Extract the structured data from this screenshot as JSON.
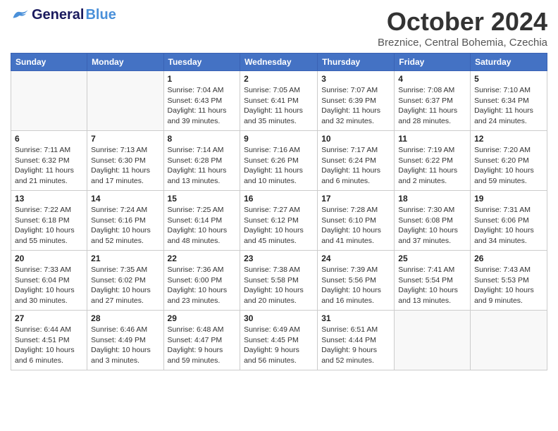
{
  "header": {
    "logo_general": "General",
    "logo_blue": "Blue",
    "month_title": "October 2024",
    "location": "Breznice, Central Bohemia, Czechia"
  },
  "weekdays": [
    "Sunday",
    "Monday",
    "Tuesday",
    "Wednesday",
    "Thursday",
    "Friday",
    "Saturday"
  ],
  "weeks": [
    [
      {
        "day": "",
        "sunrise": "",
        "sunset": "",
        "daylight": ""
      },
      {
        "day": "",
        "sunrise": "",
        "sunset": "",
        "daylight": ""
      },
      {
        "day": "1",
        "sunrise": "Sunrise: 7:04 AM",
        "sunset": "Sunset: 6:43 PM",
        "daylight": "Daylight: 11 hours and 39 minutes."
      },
      {
        "day": "2",
        "sunrise": "Sunrise: 7:05 AM",
        "sunset": "Sunset: 6:41 PM",
        "daylight": "Daylight: 11 hours and 35 minutes."
      },
      {
        "day": "3",
        "sunrise": "Sunrise: 7:07 AM",
        "sunset": "Sunset: 6:39 PM",
        "daylight": "Daylight: 11 hours and 32 minutes."
      },
      {
        "day": "4",
        "sunrise": "Sunrise: 7:08 AM",
        "sunset": "Sunset: 6:37 PM",
        "daylight": "Daylight: 11 hours and 28 minutes."
      },
      {
        "day": "5",
        "sunrise": "Sunrise: 7:10 AM",
        "sunset": "Sunset: 6:34 PM",
        "daylight": "Daylight: 11 hours and 24 minutes."
      }
    ],
    [
      {
        "day": "6",
        "sunrise": "Sunrise: 7:11 AM",
        "sunset": "Sunset: 6:32 PM",
        "daylight": "Daylight: 11 hours and 21 minutes."
      },
      {
        "day": "7",
        "sunrise": "Sunrise: 7:13 AM",
        "sunset": "Sunset: 6:30 PM",
        "daylight": "Daylight: 11 hours and 17 minutes."
      },
      {
        "day": "8",
        "sunrise": "Sunrise: 7:14 AM",
        "sunset": "Sunset: 6:28 PM",
        "daylight": "Daylight: 11 hours and 13 minutes."
      },
      {
        "day": "9",
        "sunrise": "Sunrise: 7:16 AM",
        "sunset": "Sunset: 6:26 PM",
        "daylight": "Daylight: 11 hours and 10 minutes."
      },
      {
        "day": "10",
        "sunrise": "Sunrise: 7:17 AM",
        "sunset": "Sunset: 6:24 PM",
        "daylight": "Daylight: 11 hours and 6 minutes."
      },
      {
        "day": "11",
        "sunrise": "Sunrise: 7:19 AM",
        "sunset": "Sunset: 6:22 PM",
        "daylight": "Daylight: 11 hours and 2 minutes."
      },
      {
        "day": "12",
        "sunrise": "Sunrise: 7:20 AM",
        "sunset": "Sunset: 6:20 PM",
        "daylight": "Daylight: 10 hours and 59 minutes."
      }
    ],
    [
      {
        "day": "13",
        "sunrise": "Sunrise: 7:22 AM",
        "sunset": "Sunset: 6:18 PM",
        "daylight": "Daylight: 10 hours and 55 minutes."
      },
      {
        "day": "14",
        "sunrise": "Sunrise: 7:24 AM",
        "sunset": "Sunset: 6:16 PM",
        "daylight": "Daylight: 10 hours and 52 minutes."
      },
      {
        "day": "15",
        "sunrise": "Sunrise: 7:25 AM",
        "sunset": "Sunset: 6:14 PM",
        "daylight": "Daylight: 10 hours and 48 minutes."
      },
      {
        "day": "16",
        "sunrise": "Sunrise: 7:27 AM",
        "sunset": "Sunset: 6:12 PM",
        "daylight": "Daylight: 10 hours and 45 minutes."
      },
      {
        "day": "17",
        "sunrise": "Sunrise: 7:28 AM",
        "sunset": "Sunset: 6:10 PM",
        "daylight": "Daylight: 10 hours and 41 minutes."
      },
      {
        "day": "18",
        "sunrise": "Sunrise: 7:30 AM",
        "sunset": "Sunset: 6:08 PM",
        "daylight": "Daylight: 10 hours and 37 minutes."
      },
      {
        "day": "19",
        "sunrise": "Sunrise: 7:31 AM",
        "sunset": "Sunset: 6:06 PM",
        "daylight": "Daylight: 10 hours and 34 minutes."
      }
    ],
    [
      {
        "day": "20",
        "sunrise": "Sunrise: 7:33 AM",
        "sunset": "Sunset: 6:04 PM",
        "daylight": "Daylight: 10 hours and 30 minutes."
      },
      {
        "day": "21",
        "sunrise": "Sunrise: 7:35 AM",
        "sunset": "Sunset: 6:02 PM",
        "daylight": "Daylight: 10 hours and 27 minutes."
      },
      {
        "day": "22",
        "sunrise": "Sunrise: 7:36 AM",
        "sunset": "Sunset: 6:00 PM",
        "daylight": "Daylight: 10 hours and 23 minutes."
      },
      {
        "day": "23",
        "sunrise": "Sunrise: 7:38 AM",
        "sunset": "Sunset: 5:58 PM",
        "daylight": "Daylight: 10 hours and 20 minutes."
      },
      {
        "day": "24",
        "sunrise": "Sunrise: 7:39 AM",
        "sunset": "Sunset: 5:56 PM",
        "daylight": "Daylight: 10 hours and 16 minutes."
      },
      {
        "day": "25",
        "sunrise": "Sunrise: 7:41 AM",
        "sunset": "Sunset: 5:54 PM",
        "daylight": "Daylight: 10 hours and 13 minutes."
      },
      {
        "day": "26",
        "sunrise": "Sunrise: 7:43 AM",
        "sunset": "Sunset: 5:53 PM",
        "daylight": "Daylight: 10 hours and 9 minutes."
      }
    ],
    [
      {
        "day": "27",
        "sunrise": "Sunrise: 6:44 AM",
        "sunset": "Sunset: 4:51 PM",
        "daylight": "Daylight: 10 hours and 6 minutes."
      },
      {
        "day": "28",
        "sunrise": "Sunrise: 6:46 AM",
        "sunset": "Sunset: 4:49 PM",
        "daylight": "Daylight: 10 hours and 3 minutes."
      },
      {
        "day": "29",
        "sunrise": "Sunrise: 6:48 AM",
        "sunset": "Sunset: 4:47 PM",
        "daylight": "Daylight: 9 hours and 59 minutes."
      },
      {
        "day": "30",
        "sunrise": "Sunrise: 6:49 AM",
        "sunset": "Sunset: 4:45 PM",
        "daylight": "Daylight: 9 hours and 56 minutes."
      },
      {
        "day": "31",
        "sunrise": "Sunrise: 6:51 AM",
        "sunset": "Sunset: 4:44 PM",
        "daylight": "Daylight: 9 hours and 52 minutes."
      },
      {
        "day": "",
        "sunrise": "",
        "sunset": "",
        "daylight": ""
      },
      {
        "day": "",
        "sunrise": "",
        "sunset": "",
        "daylight": ""
      }
    ]
  ]
}
